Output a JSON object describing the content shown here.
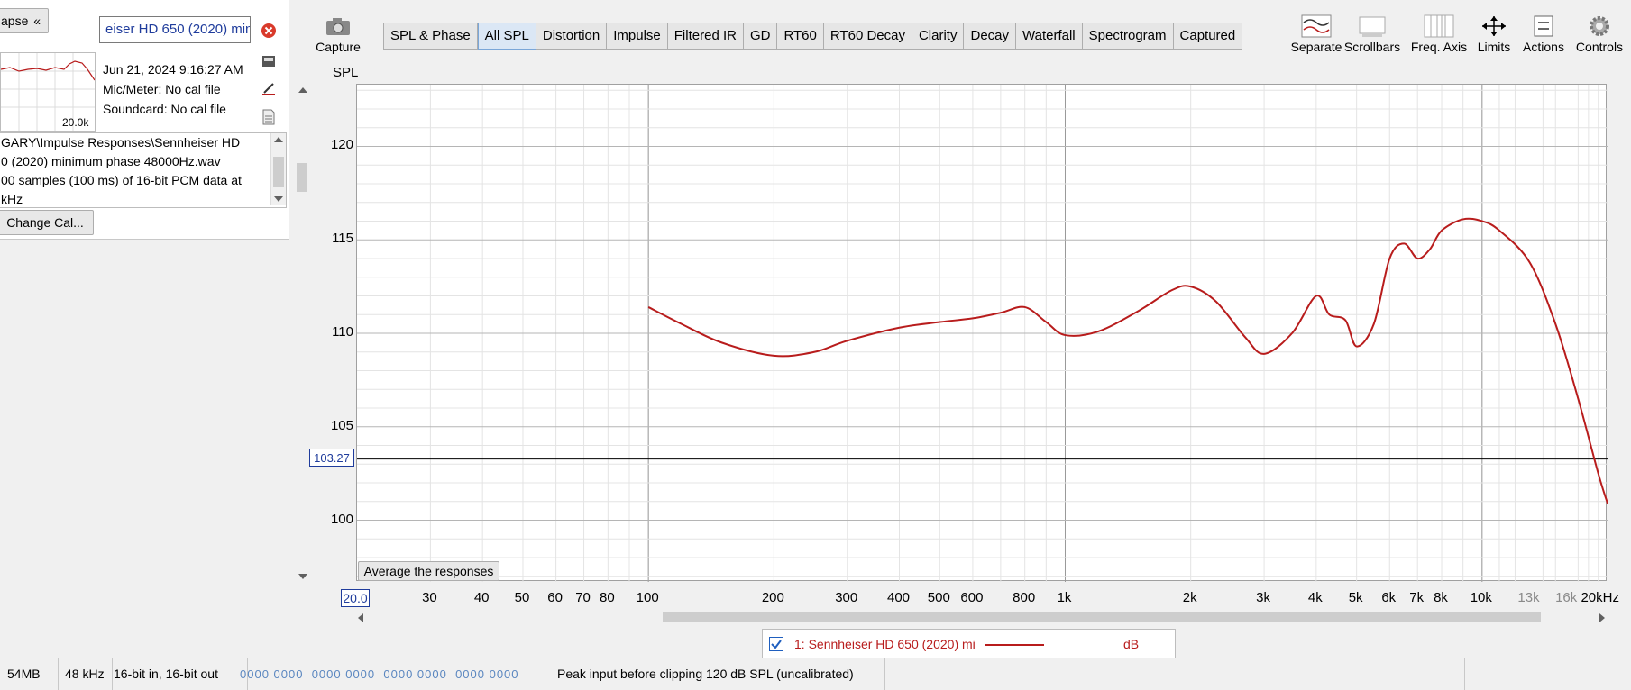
{
  "left_panel": {
    "collapse_label": "apse",
    "collapse_chevron": "«",
    "name_field_value": "eiser HD 650 (2020) min",
    "thumb_freq_label": "20.0k",
    "date": "Jun 21, 2024 9:16:27 AM",
    "mic_meter": "Mic/Meter: No cal file",
    "soundcard": "Soundcard: No cal file",
    "notes_lines": [
      "GARY\\Impulse Responses\\Sennheiser HD",
      "0 (2020) minimum phase 48000Hz.wav",
      "00 samples (100 ms) of 16-bit PCM data at",
      "kHz"
    ],
    "change_cal_label": "Change Cal..."
  },
  "toolbar": {
    "capture_label": "Capture",
    "tabs": [
      "SPL & Phase",
      "All SPL",
      "Distortion",
      "Impulse",
      "Filtered IR",
      "GD",
      "RT60",
      "RT60 Decay",
      "Clarity",
      "Decay",
      "Waterfall",
      "Spectrogram",
      "Captured"
    ],
    "active_tab": "All SPL",
    "tools": [
      "Separate",
      "Scrollbars",
      "Freq. Axis",
      "Limits",
      "Actions",
      "Controls"
    ]
  },
  "plot": {
    "y_axis_title": "SPL",
    "cursor_value": "103.27",
    "average_button": "Average the responses",
    "x_start_label": "20.0",
    "legend_label": "1: Sennheiser HD 650 (2020) mi",
    "legend_unit": "dB",
    "line_color": "#b81c1c"
  },
  "chart_data": {
    "type": "line",
    "xlabel": "",
    "ylabel": "SPL",
    "x_scale": "log",
    "xlim": [
      20,
      20000
    ],
    "ylim": [
      96.7,
      123.3
    ],
    "y_ticks": [
      100,
      105,
      110,
      115,
      120
    ],
    "x_ticks": [
      {
        "f": 30,
        "label": "30"
      },
      {
        "f": 40,
        "label": "40"
      },
      {
        "f": 50,
        "label": "50"
      },
      {
        "f": 60,
        "label": "60"
      },
      {
        "f": 70,
        "label": "70"
      },
      {
        "f": 80,
        "label": "80"
      },
      {
        "f": 100,
        "label": "100"
      },
      {
        "f": 200,
        "label": "200"
      },
      {
        "f": 300,
        "label": "300"
      },
      {
        "f": 400,
        "label": "400"
      },
      {
        "f": 500,
        "label": "500"
      },
      {
        "f": 600,
        "label": "600"
      },
      {
        "f": 800,
        "label": "800"
      },
      {
        "f": 1000,
        "label": "1k"
      },
      {
        "f": 2000,
        "label": "2k"
      },
      {
        "f": 3000,
        "label": "3k"
      },
      {
        "f": 4000,
        "label": "4k"
      },
      {
        "f": 5000,
        "label": "5k"
      },
      {
        "f": 6000,
        "label": "6k"
      },
      {
        "f": 7000,
        "label": "7k"
      },
      {
        "f": 8000,
        "label": "8k"
      },
      {
        "f": 10000,
        "label": "10k"
      },
      {
        "f": 13000,
        "label": "13k"
      },
      {
        "f": 16000,
        "label": "16k"
      },
      {
        "f": 20000,
        "label": "20kHz"
      }
    ],
    "cursor_y": 103.27,
    "series": [
      {
        "name": "1: Sennheiser HD 650 (2020) mi",
        "color": "#b81c1c",
        "points": [
          [
            100,
            111.4
          ],
          [
            120,
            110.5
          ],
          [
            150,
            109.5
          ],
          [
            200,
            108.8
          ],
          [
            250,
            109.0
          ],
          [
            300,
            109.6
          ],
          [
            400,
            110.3
          ],
          [
            500,
            110.6
          ],
          [
            600,
            110.8
          ],
          [
            700,
            111.1
          ],
          [
            800,
            111.4
          ],
          [
            900,
            110.6
          ],
          [
            1000,
            109.9
          ],
          [
            1200,
            110.1
          ],
          [
            1500,
            111.2
          ],
          [
            1800,
            112.3
          ],
          [
            2000,
            112.5
          ],
          [
            2300,
            111.7
          ],
          [
            2700,
            109.8
          ],
          [
            3000,
            108.9
          ],
          [
            3500,
            110.0
          ],
          [
            4000,
            112.0
          ],
          [
            4300,
            111.0
          ],
          [
            4700,
            110.7
          ],
          [
            5000,
            109.3
          ],
          [
            5500,
            110.5
          ],
          [
            6000,
            114.0
          ],
          [
            6500,
            114.8
          ],
          [
            7000,
            114.0
          ],
          [
            7500,
            114.5
          ],
          [
            8000,
            115.5
          ],
          [
            9000,
            116.1
          ],
          [
            10000,
            116.0
          ],
          [
            11000,
            115.5
          ],
          [
            13000,
            113.8
          ],
          [
            15000,
            110.5
          ],
          [
            17000,
            106.5
          ],
          [
            19000,
            102.5
          ],
          [
            20000,
            100.9
          ]
        ]
      }
    ]
  },
  "status_bar": {
    "memory": "54MB",
    "sample_rate": "48 kHz",
    "bit_depth": "16-bit in, 16-bit out",
    "levels": [
      "0000 0000",
      "0000 0000",
      "0000 0000",
      "0000 0000"
    ],
    "peak_message": "Peak input before clipping 120 dB SPL (uncalibrated)"
  }
}
